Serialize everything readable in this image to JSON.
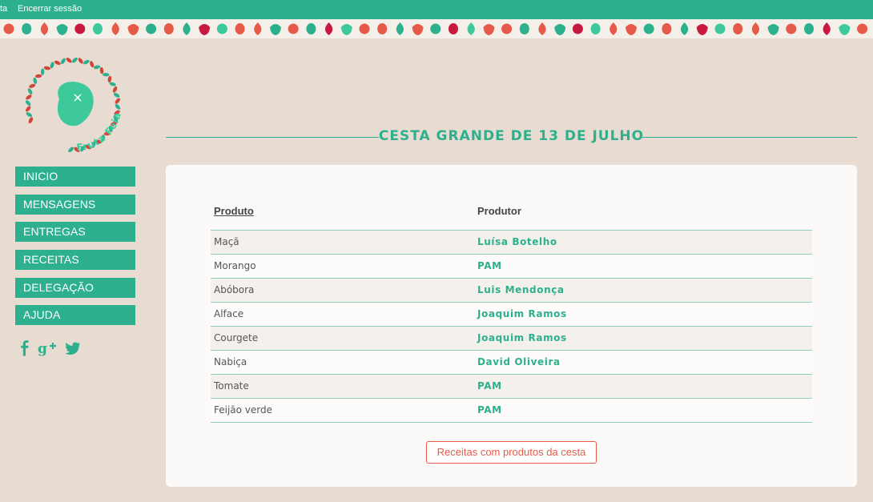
{
  "topbar": {
    "left_fragment": "ta",
    "logout_label": "Encerrar sessão"
  },
  "logo": {
    "text": "Fruta Feia"
  },
  "nav": {
    "items": [
      {
        "label": "INICIO"
      },
      {
        "label": "MENSAGENS"
      },
      {
        "label": "ENTREGAS"
      },
      {
        "label": "RECEITAS"
      },
      {
        "label": "DELEGAÇÃO"
      },
      {
        "label": "AJUDA"
      }
    ]
  },
  "social": {
    "icons": [
      "facebook-icon",
      "google-plus-icon",
      "twitter-icon"
    ]
  },
  "page": {
    "title": "CESTA GRANDE DE 13 DE JULHO"
  },
  "table": {
    "headers": {
      "product": "Produto",
      "producer": "Produtor"
    },
    "rows": [
      {
        "product": "Maçã",
        "producer": "Luísa Botelho"
      },
      {
        "product": "Morango",
        "producer": "PAM"
      },
      {
        "product": "Abóbora",
        "producer": "Luis Mendonça"
      },
      {
        "product": "Alface",
        "producer": "Joaquim Ramos"
      },
      {
        "product": "Courgete",
        "producer": "Joaquim Ramos"
      },
      {
        "product": "Nabiça",
        "producer": "David Oliveira"
      },
      {
        "product": "Tomate",
        "producer": "PAM"
      },
      {
        "product": "Feijão verde",
        "producer": "PAM"
      }
    ]
  },
  "recipes_button": {
    "label": "Receitas com produtos da cesta"
  },
  "colors": {
    "accent": "#2db08d",
    "background": "#e8dcd2",
    "button_red": "#e65a4a"
  }
}
